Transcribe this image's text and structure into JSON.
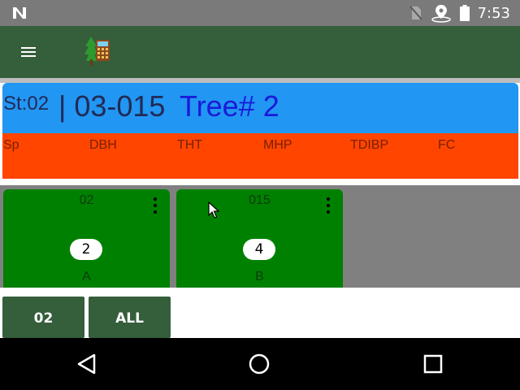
{
  "status_bar": {
    "time": "7:53",
    "icons": [
      "n-notification-icon",
      "no-sim-icon",
      "location-icon",
      "battery-icon"
    ]
  },
  "app_bar": {
    "icons": [
      "menu-icon",
      "app-logo-icon"
    ]
  },
  "tree_header": {
    "stand": "St:02",
    "plot": "| 03-015",
    "tree": "Tree# 2",
    "columns": [
      "Sp",
      "DBH",
      "THT",
      "MHP",
      "TDIBP",
      "FC"
    ]
  },
  "tiles": [
    {
      "top": "02",
      "count": "2",
      "bottom": "A"
    },
    {
      "top": "015",
      "count": "4",
      "bottom": "B"
    }
  ],
  "filters": [
    "02",
    "ALL"
  ],
  "nav_icons": [
    "back-icon",
    "home-icon",
    "recents-icon"
  ],
  "colors": {
    "status_bar": "#7a7a7a",
    "app_bar": "#355e3b",
    "header_blue": "#2196f3",
    "header_orange": "#ff4500",
    "tile_green": "#008000",
    "tile_area": "#808080",
    "nav_bar": "#000000"
  }
}
